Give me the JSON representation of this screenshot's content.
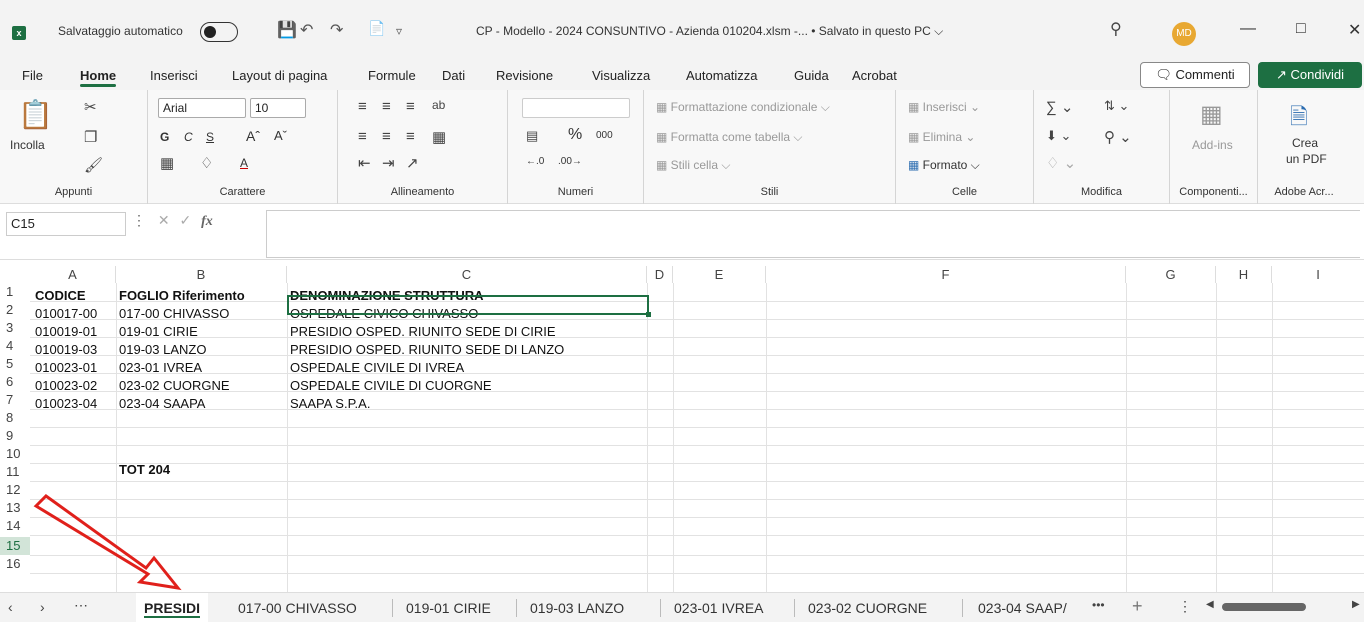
{
  "titlebar": {
    "app_icon": "excel-icon",
    "autosave_label": "Salvataggio automatico",
    "autosave_state": "off",
    "title": "CP - Modello - 2024 CONSUNTIVO - Azienda 010204.xlsm -...  •  Salvato in questo PC ⌵",
    "avatar": "MD"
  },
  "menu": {
    "items": [
      "File",
      "Home",
      "Inserisci",
      "Layout di pagina",
      "Formule",
      "Dati",
      "Revisione",
      "Visualizza",
      "Automatizza",
      "Guida",
      "Acrobat"
    ],
    "active": "Home",
    "comments": "Commenti",
    "share": "Condividi"
  },
  "ribbon": {
    "paste": "Incolla",
    "font_name": "Arial",
    "font_size": "10",
    "clipboard_label": "Appunti",
    "font_label": "Carattere",
    "align_label": "Allineamento",
    "number_label": "Numeri",
    "styles": {
      "conditional": "Formattazione condizionale ⌵",
      "as_table": "Formatta come tabella ⌵",
      "cell_styles": "Stili cella ⌵",
      "label": "Stili"
    },
    "cells": {
      "insert": "Inserisci",
      "delete": "Elimina",
      "format": "Formato ⌵",
      "label": "Celle"
    },
    "edit_label": "Modifica",
    "addins": "Add-ins",
    "addins_label": "Componenti...",
    "pdf_line1": "Crea",
    "pdf_line2": "un PDF",
    "adobe_label": "Adobe Acr..."
  },
  "formula_bar": {
    "name_box": "C15",
    "fx": "fx",
    "value": ""
  },
  "grid": {
    "columns": [
      "A",
      "B",
      "C",
      "D",
      "E",
      "F",
      "G",
      "H",
      "I"
    ],
    "rows": [
      [
        "CODICE",
        "FOGLIO Riferimento",
        "DENOMINAZIONE STRUTTURA"
      ],
      [
        "010017-00",
        "017-00 CHIVASSO",
        "OSPEDALE CIVICO CHIVASSO"
      ],
      [
        "010019-01",
        "019-01 CIRIE",
        "PRESIDIO OSPED. RIUNITO SEDE DI CIRIE"
      ],
      [
        "010019-03",
        "019-03 LANZO",
        "PRESIDIO OSPED. RIUNITO SEDE DI LANZO"
      ],
      [
        "010023-01",
        "023-01 IVREA",
        "OSPEDALE CIVILE DI IVREA"
      ],
      [
        "010023-02",
        "023-02 CUORGNE",
        "OSPEDALE CIVILE DI CUORGNE"
      ],
      [
        "010023-04",
        "023-04 SAAPA",
        "SAAPA S.P.A."
      ]
    ],
    "total_label": "TOT 204",
    "row_numbers": [
      "1",
      "2",
      "3",
      "4",
      "5",
      "6",
      "7",
      "8",
      "9",
      "10",
      "11",
      "12",
      "13",
      "14",
      "15",
      "16"
    ],
    "selected_cell": "C15"
  },
  "sheets": {
    "tabs": [
      "PRESIDI",
      "017-00 CHIVASSO",
      "019-01 CIRIE",
      "019-03 LANZO",
      "023-01 IVREA",
      "023-02 CUORGNE",
      "023-04 SAAP/"
    ],
    "active": "PRESIDI",
    "more": "•••",
    "add": "+"
  },
  "colors": {
    "accent": "#1d6f42",
    "annotation_arrow": "#e0201b"
  }
}
